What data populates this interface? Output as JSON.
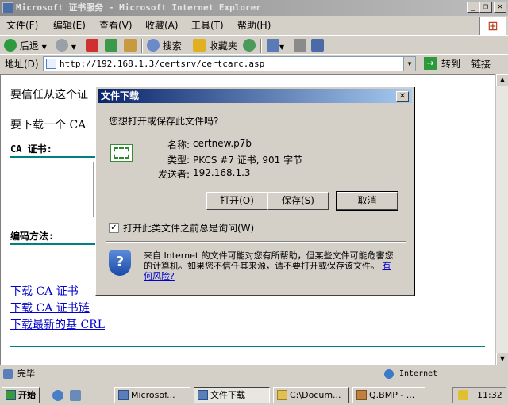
{
  "window": {
    "title": "Microsoft 证书服务 - Microsoft Internet Explorer",
    "minimize": "_",
    "restore": "❐",
    "close": "✕"
  },
  "menu": [
    "文件(F)",
    "编辑(E)",
    "查看(V)",
    "收藏(A)",
    "工具(T)",
    "帮助(H)"
  ],
  "toolbar": {
    "back": "后退",
    "search": "搜索",
    "favorites": "收藏夹"
  },
  "address": {
    "label": "地址(D)",
    "url": "http://192.168.1.3/certsrv/certcarc.asp",
    "go": "转到",
    "links": "链接"
  },
  "page": {
    "line1": "要信任从这个证",
    "line2": "要下载一个 CA",
    "ca_cert_label": "CA 证书:",
    "encoding_label": "编码方法:",
    "links": [
      "下载 CA 证书",
      "下载 CA 证书链",
      "下载最新的基 CRL"
    ]
  },
  "dialog": {
    "title": "文件下载",
    "question": "您想打开或保存此文件吗?",
    "name_label": "名称:",
    "name_value": "certnew.p7b",
    "type_label": "类型:",
    "type_value": "PKCS #7 证书, 901 字节",
    "from_label": "发送者:",
    "from_value": "192.168.1.3",
    "open_button": "打开(O)",
    "save_button": "保存(S)",
    "cancel_button": "取消",
    "checkbox_label": "打开此类文件之前总是询问(W)",
    "checkbox_checked": true,
    "warning_text": "来自 Internet 的文件可能对您有所帮助，但某些文件可能危害您的计算机。如果您不信任其来源，请不要打开或保存该文件。",
    "risk_link": "有何风险?"
  },
  "status": {
    "text": "完毕",
    "zone": "Internet"
  },
  "taskbar": {
    "start": "开始",
    "tasks": [
      "Microsof...",
      "文件下载",
      "C:\\Docum...",
      "Q.BMP - ..."
    ],
    "clock": "11:32"
  },
  "colors": {
    "title_active_start": "#0a246a",
    "title_active_end": "#a6caf0",
    "link": "#0000cc",
    "teal_rule": "#008080"
  }
}
